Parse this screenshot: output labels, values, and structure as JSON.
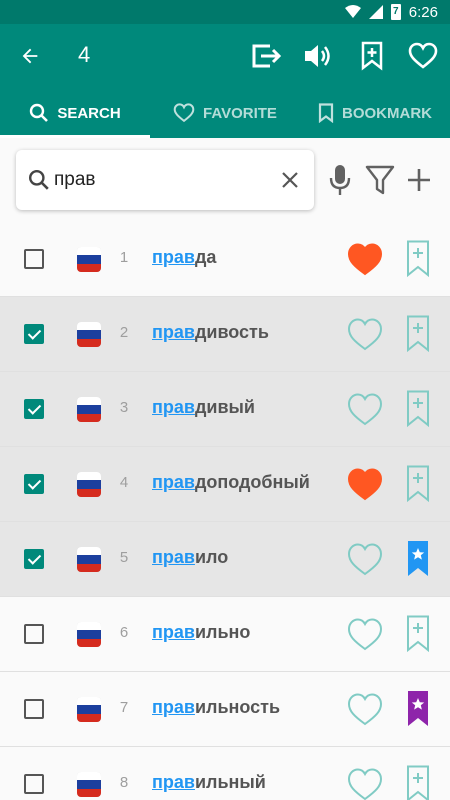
{
  "status_bar": {
    "time": "6:26",
    "battery_label": "7"
  },
  "app_bar": {
    "selected_count": "4"
  },
  "tabs": [
    {
      "label": "SEARCH",
      "icon": "search-icon",
      "active": true
    },
    {
      "label": "FAVORITE",
      "icon": "heart-icon",
      "active": false
    },
    {
      "label": "BOOKMARK",
      "icon": "bookmark-icon",
      "active": false
    }
  ],
  "search": {
    "value": "прав",
    "placeholder": ""
  },
  "colors": {
    "primary": "#00897b",
    "status_bar": "#00796b",
    "match_blue": "#2196f3",
    "favorite_orange": "#ff5722",
    "bookmark_blue": "#2196f3",
    "bookmark_purple": "#8e24aa",
    "outline_teal": "#80cbc4"
  },
  "rows": [
    {
      "number": "1",
      "match": "прав",
      "rest": "да",
      "checked": false,
      "favorite": true,
      "bookmark": "none"
    },
    {
      "number": "2",
      "match": "прав",
      "rest": "дивость",
      "checked": true,
      "favorite": false,
      "bookmark": "none"
    },
    {
      "number": "3",
      "match": "прав",
      "rest": "дивый",
      "checked": true,
      "favorite": false,
      "bookmark": "none"
    },
    {
      "number": "4",
      "match": "прав",
      "rest": "доподобный",
      "checked": true,
      "favorite": true,
      "bookmark": "none"
    },
    {
      "number": "5",
      "match": "прав",
      "rest": "ило",
      "checked": true,
      "favorite": false,
      "bookmark": "blue"
    },
    {
      "number": "6",
      "match": "прав",
      "rest": "ильно",
      "checked": false,
      "favorite": false,
      "bookmark": "none"
    },
    {
      "number": "7",
      "match": "прав",
      "rest": "ильность",
      "checked": false,
      "favorite": false,
      "bookmark": "purple"
    },
    {
      "number": "8",
      "match": "прав",
      "rest": "ильный",
      "checked": false,
      "favorite": false,
      "bookmark": "none"
    }
  ]
}
